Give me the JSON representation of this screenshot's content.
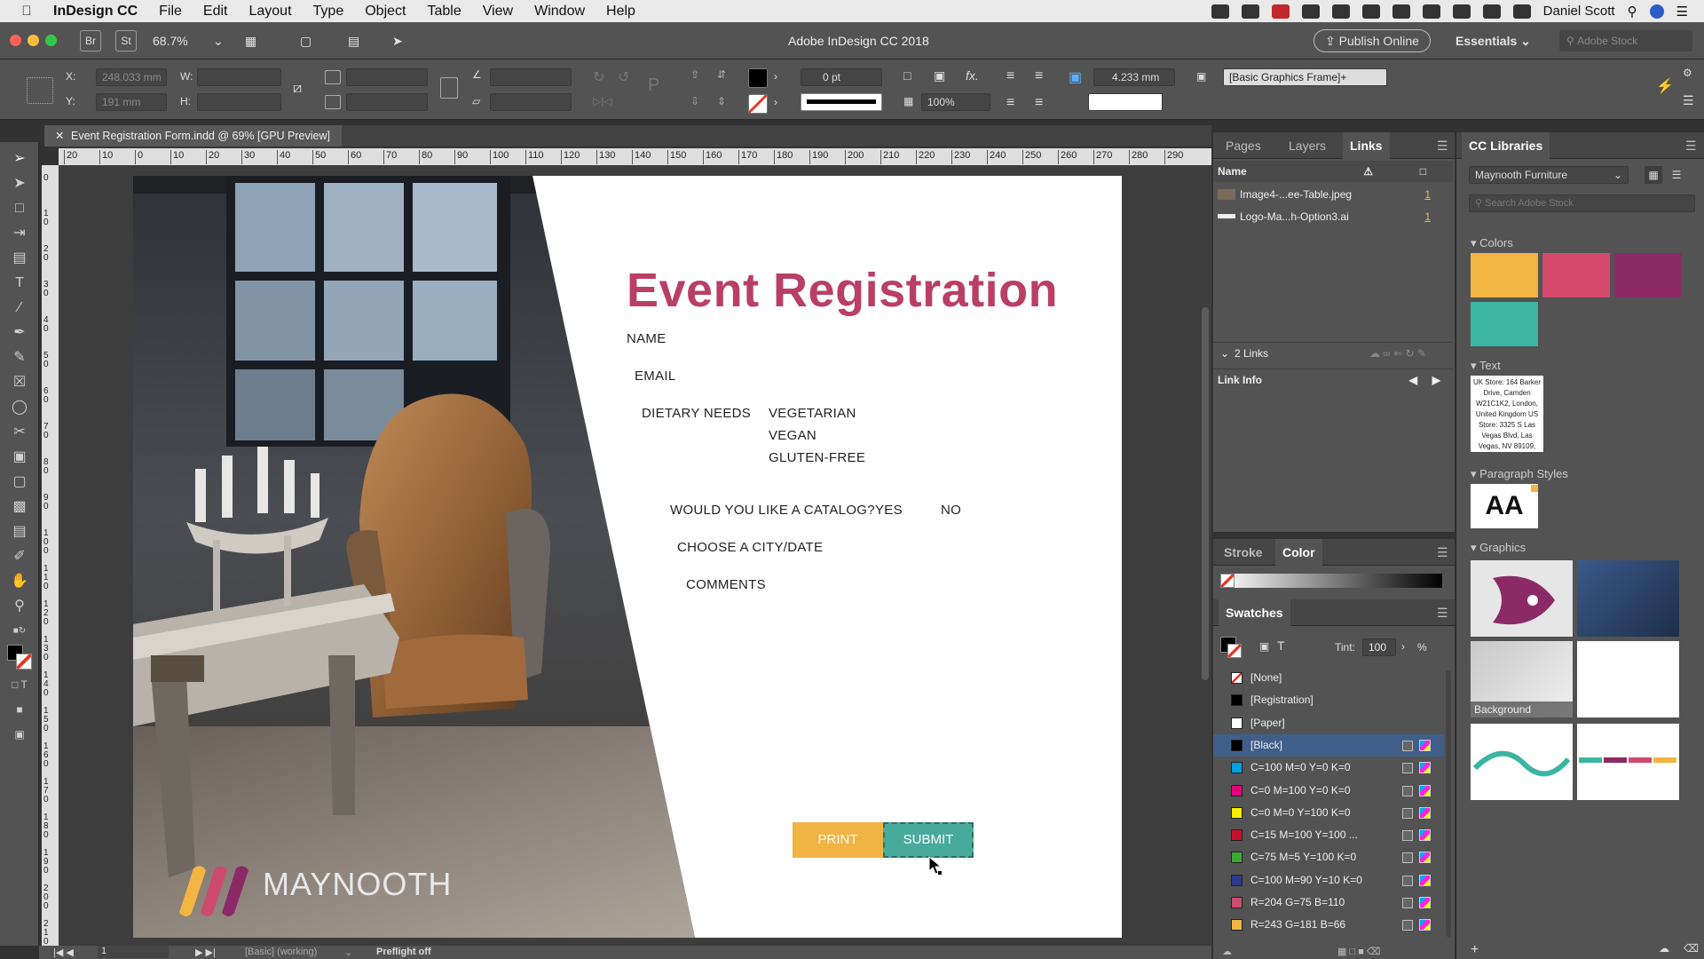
{
  "menubar": {
    "app_name": "InDesign CC",
    "items": [
      "File",
      "Edit",
      "Layout",
      "Type",
      "Object",
      "Table",
      "View",
      "Window",
      "Help"
    ],
    "user": "Daniel Scott"
  },
  "appbar": {
    "br": "Br",
    "st": "St",
    "zoom": "68.7%",
    "window_title": "Adobe InDesign CC 2018",
    "publish": "Publish Online",
    "workspace": "Essentials",
    "search_placeholder": "Adobe Stock"
  },
  "control": {
    "x_label": "X:",
    "x_value": "248.033 mm",
    "y_label": "Y:",
    "y_value": "191 mm",
    "w_label": "W:",
    "h_label": "H:",
    "stroke_weight": "0 pt",
    "opacity": "100%",
    "size_value": "4.233 mm",
    "object_style": "[Basic Graphics Frame]+"
  },
  "document_tab": "Event Registration Form.indd @ 69% [GPU Preview]",
  "ruler_h": [
    "20",
    "10",
    "0",
    "10",
    "20",
    "30",
    "40",
    "50",
    "60",
    "70",
    "80",
    "90",
    "100",
    "110",
    "120",
    "130",
    "140",
    "150",
    "160",
    "170",
    "180",
    "190",
    "200",
    "210",
    "220",
    "230",
    "240",
    "250",
    "260",
    "270",
    "280",
    "290"
  ],
  "ruler_v": [
    "0",
    "1 0",
    "2 0",
    "3 0",
    "4 0",
    "5 0",
    "6 0",
    "7 0",
    "8 0",
    "9 0",
    "1 0 0",
    "1 1 0",
    "1 2 0",
    "1 3 0",
    "1 4 0",
    "1 5 0",
    "1 6 0",
    "1 7 0",
    "1 8 0",
    "1 9 0",
    "2 0 0",
    "2 1 0"
  ],
  "form": {
    "title": "Event Registration",
    "name": "NAME",
    "email": "EMAIL",
    "dietary": "DIETARY NEEDS",
    "vegetarian": "VEGETARIAN",
    "vegan": "VEGAN",
    "gluten": "GLUTEN-FREE",
    "catalog": "WOULD YOU LIKE A CATALOG?",
    "yes": "YES",
    "no": "NO",
    "city": "CHOOSE A CITY/DATE",
    "comments": "COMMENTS",
    "print": "PRINT",
    "submit": "SUBMIT",
    "logo": "MAYNOOTH"
  },
  "status": {
    "page": "1",
    "style": "[Basic] (working)",
    "preflight": "Preflight off"
  },
  "links_panel": {
    "tabs": [
      "Pages",
      "Layers",
      "Links"
    ],
    "col_name": "Name",
    "items": [
      {
        "name": "Image4-...ee-Table.jpeg",
        "page": "1"
      },
      {
        "name": "Logo-Ma...h-Option3.ai",
        "page": "1"
      }
    ],
    "count": "2 Links",
    "info": "Link Info"
  },
  "color_panel": {
    "tabs": [
      "Stroke",
      "Color"
    ]
  },
  "swatches": {
    "title": "Swatches",
    "tint_label": "Tint:",
    "tint_value": "100",
    "pct": "%",
    "rows": [
      {
        "name": "[None]",
        "color": "#ffffff"
      },
      {
        "name": "[Registration]",
        "color": "#000000"
      },
      {
        "name": "[Paper]",
        "color": "#ffffff"
      },
      {
        "name": "[Black]",
        "color": "#000000"
      },
      {
        "name": "C=100 M=0 Y=0 K=0",
        "color": "#00a0e3"
      },
      {
        "name": "C=0 M=100 Y=0 K=0",
        "color": "#e6007e"
      },
      {
        "name": "C=0 M=0 Y=100 K=0",
        "color": "#ffed00"
      },
      {
        "name": "C=15 M=100 Y=100 ...",
        "color": "#c8102e"
      },
      {
        "name": "C=75 M=5 Y=100 K=0",
        "color": "#3aaa35"
      },
      {
        "name": "C=100 M=90 Y=10 K=0",
        "color": "#2c3a8c"
      },
      {
        "name": "R=204 G=75 B=110",
        "color": "#cc4b6e"
      },
      {
        "name": "R=243 G=181 B=66",
        "color": "#f3b542"
      }
    ]
  },
  "cc_libraries": {
    "title": "CC Libraries",
    "library": "Maynooth Furniture",
    "search_placeholder": "Search Adobe Stock",
    "colors_label": "Colors",
    "colors": [
      "#f3b542",
      "#d64a6e",
      "#8c2a68",
      "#3ab5a3"
    ],
    "text_label": "Text",
    "text_sample": "UK Store: 164 Barker Drive, Camden W21C1K2, London, United Kingdom US Store: 3325 S Las Vegas Blvd, Las Vegas, NV 89109,",
    "para_label": "Paragraph Styles",
    "para_sample": "AA",
    "graphics_label": "Graphics",
    "background_label": "Background"
  }
}
